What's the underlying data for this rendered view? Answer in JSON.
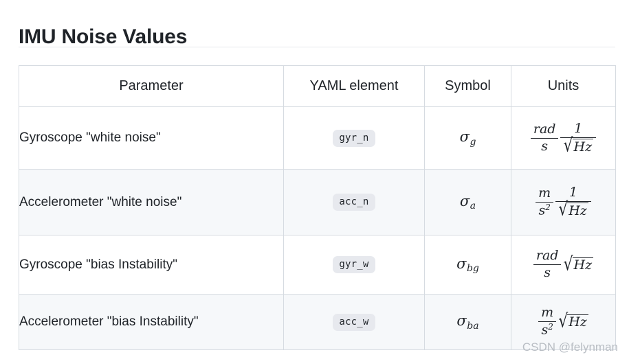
{
  "document": {
    "title": "IMU Noise Values"
  },
  "table": {
    "headers": [
      {
        "label": "Parameter"
      },
      {
        "label": "YAML element"
      },
      {
        "label": "Symbol"
      },
      {
        "label": "Units"
      }
    ],
    "rows": [
      {
        "parameter": "Gyroscope \"white noise\"",
        "yaml_element": "gyr_n",
        "symbol_base": "σ",
        "symbol_sub": "g",
        "units_plain": "rad/s · 1/√Hz",
        "units": {
          "frac1_num": "rad",
          "frac1_den": "s",
          "frac2_num": "1",
          "frac2_den_radicand": "Hz",
          "trailing_radicand": ""
        }
      },
      {
        "parameter": "Accelerometer \"white noise\"",
        "yaml_element": "acc_n",
        "symbol_base": "σ",
        "symbol_sub": "a",
        "units_plain": "m/s² · 1/√Hz",
        "units": {
          "frac1_num": "m",
          "frac1_den": "s",
          "frac1_den_sup": "2",
          "frac2_num": "1",
          "frac2_den_radicand": "Hz",
          "trailing_radicand": ""
        }
      },
      {
        "parameter": "Gyroscope \"bias Instability\"",
        "yaml_element": "gyr_w",
        "symbol_base": "σ",
        "symbol_sub": "bg",
        "units_plain": "rad/s · √Hz",
        "units": {
          "frac1_num": "rad",
          "frac1_den": "s",
          "trailing_radicand": "Hz"
        }
      },
      {
        "parameter": "Accelerometer \"bias Instability\"",
        "yaml_element": "acc_w",
        "symbol_base": "σ",
        "symbol_sub": "ba",
        "units_plain": "m/s² · √Hz",
        "units": {
          "frac1_num": "m",
          "frac1_den": "s",
          "frac1_den_sup": "2",
          "trailing_radicand": "Hz"
        }
      }
    ]
  },
  "watermark": {
    "text": "CSDN @felynman"
  },
  "colors": {
    "title": "#1f2328",
    "text": "#1f2328",
    "border": "#d6dbe1",
    "row_alt_bg": "#f6f8fa",
    "chip_bg": "#e7e9ee",
    "rule": "#e6e8eb",
    "watermark": "#b9bec4"
  }
}
